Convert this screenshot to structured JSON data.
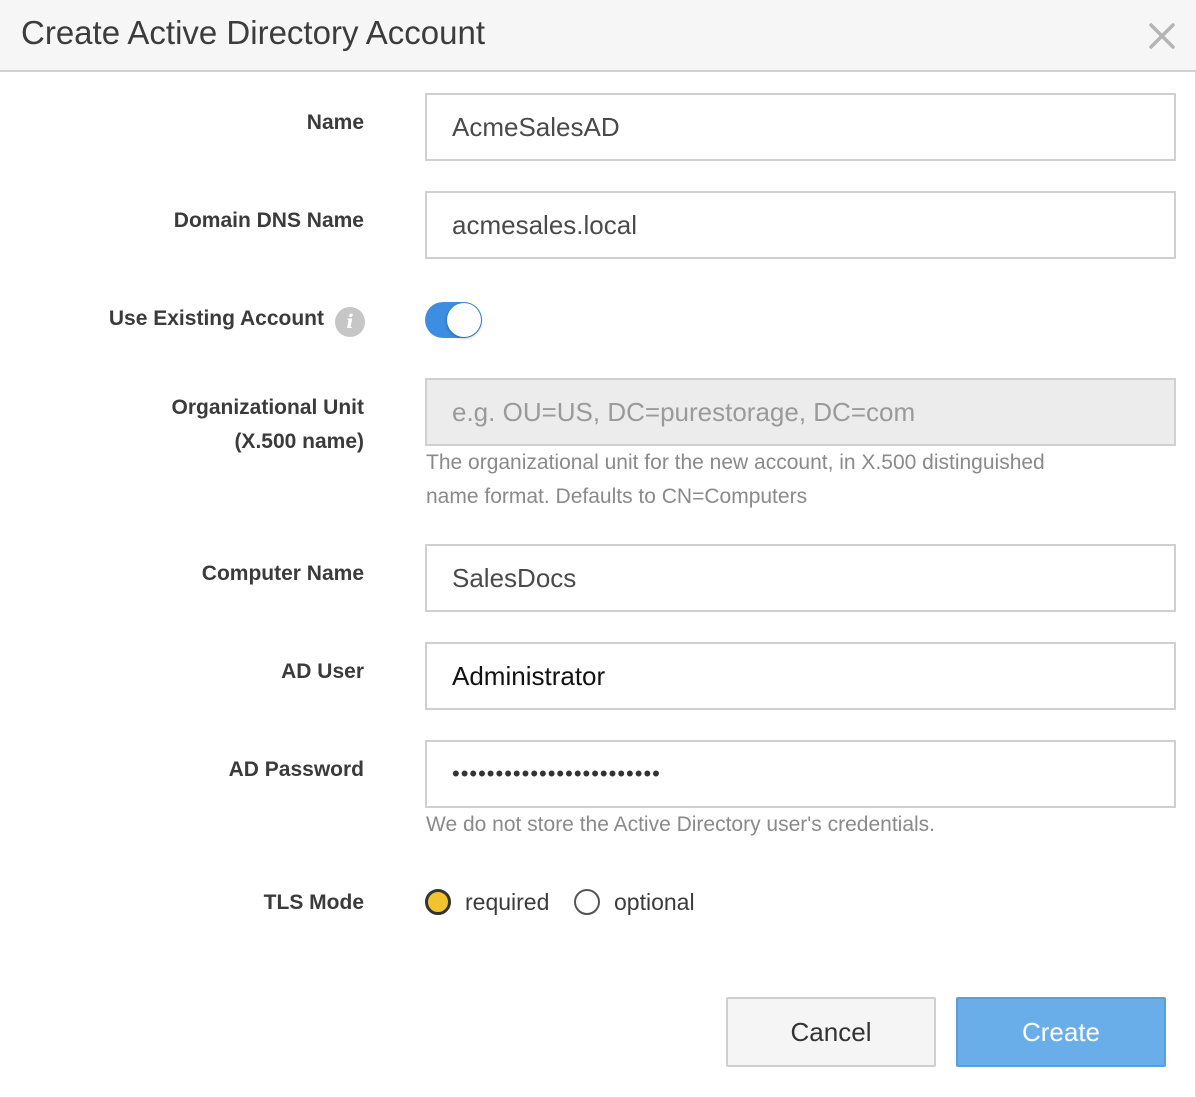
{
  "dialog": {
    "title": "Create Active Directory Account",
    "close_icon": "close-icon"
  },
  "form": {
    "name": {
      "label": "Name",
      "value": "AcmeSalesAD"
    },
    "domain_dns_name": {
      "label": "Domain DNS Name",
      "value": "acmesales.local"
    },
    "use_existing_account": {
      "label": "Use Existing Account",
      "info_icon": "info-icon",
      "info_glyph": "i",
      "enabled": true
    },
    "organizational_unit": {
      "label_line1": "Organizational Unit",
      "label_line2": "(X.500 name)",
      "value": "",
      "placeholder": "e.g. OU=US, DC=purestorage, DC=com",
      "help_line1": "The organizational unit for the new account, in X.500 distinguished",
      "help_line2": "name format. Defaults to CN=Computers",
      "disabled": true
    },
    "computer_name": {
      "label": "Computer Name",
      "value": "SalesDocs"
    },
    "ad_user": {
      "label": "AD User",
      "value": "Administrator"
    },
    "ad_password": {
      "label": "AD Password",
      "value": "••••••••••••••••••••••••",
      "help": "We do not store the Active Directory user's credentials."
    },
    "tls_mode": {
      "label": "TLS Mode",
      "options": [
        {
          "label": "required",
          "checked": true
        },
        {
          "label": "optional",
          "checked": false
        }
      ]
    }
  },
  "buttons": {
    "cancel": "Cancel",
    "create": "Create"
  },
  "colors": {
    "toggle_on": "#3d8ee1",
    "radio_checked": "#f2c32e",
    "create_button": "#6aaee9"
  }
}
